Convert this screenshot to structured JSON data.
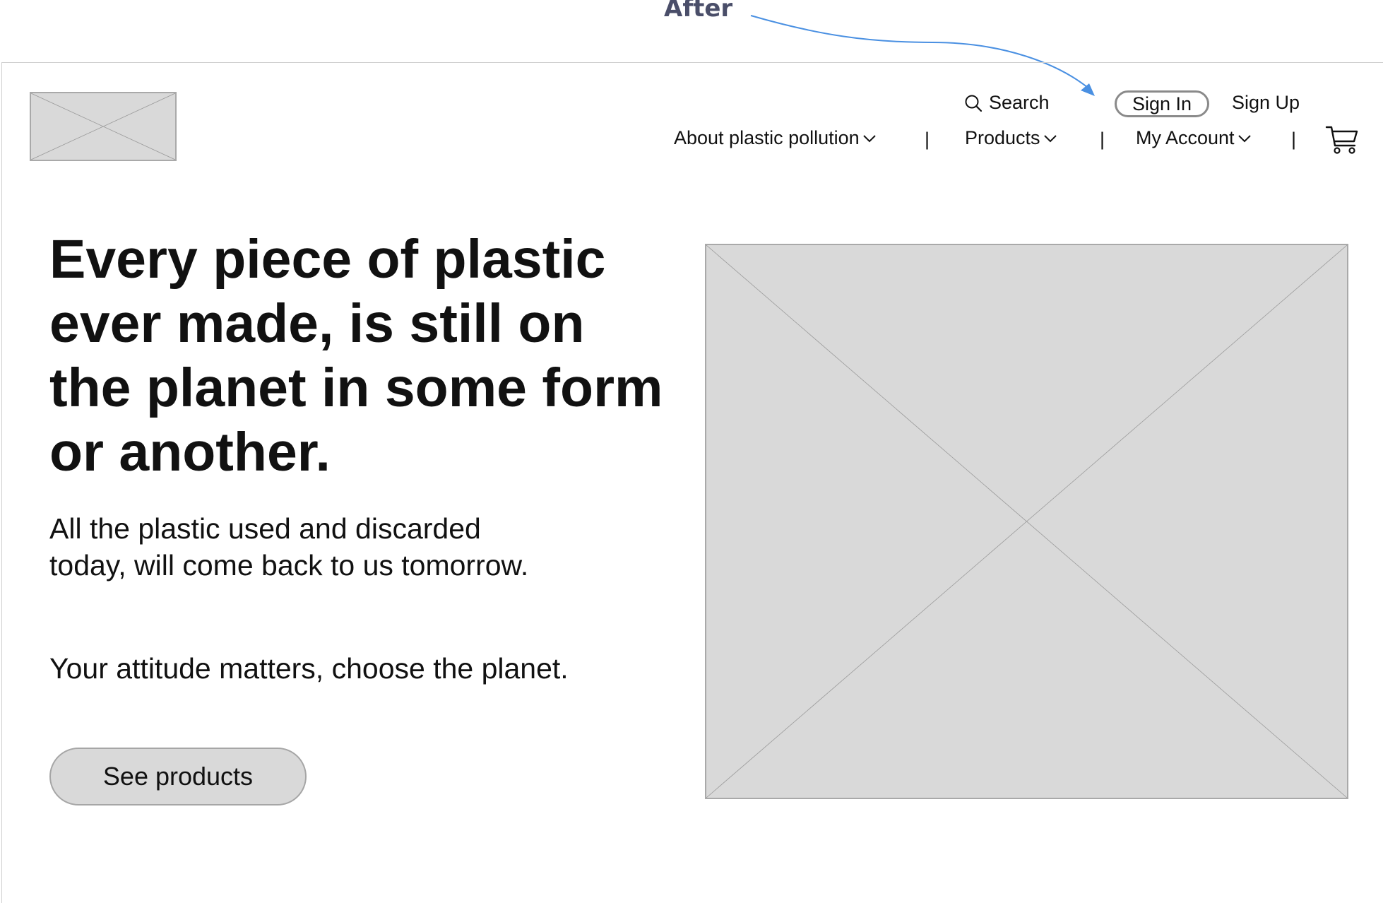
{
  "annotation": {
    "label": "After"
  },
  "header": {
    "search_label": "Search",
    "sign_in_label": "Sign In",
    "sign_up_label": "Sign Up",
    "nav": [
      {
        "label": "About plastic pollution"
      },
      {
        "label": "Products"
      },
      {
        "label": "My Account"
      }
    ],
    "separator": "|",
    "icons": {
      "search": "search-icon",
      "cart": "cart-icon",
      "chevron": "chevron-down-icon"
    }
  },
  "hero": {
    "headline": "Every piece of plastic ever made, is still on the planet in some form or another.",
    "subtext": "All the plastic used and discarded today, will come back to us tomorrow.",
    "tagline": "Your attitude matters, choose the planet.",
    "cta_label": "See products"
  },
  "colors": {
    "placeholder_fill": "#d9d9d9",
    "annotation_text": "#4a4e69",
    "annotation_arrow": "#4a90e2"
  }
}
